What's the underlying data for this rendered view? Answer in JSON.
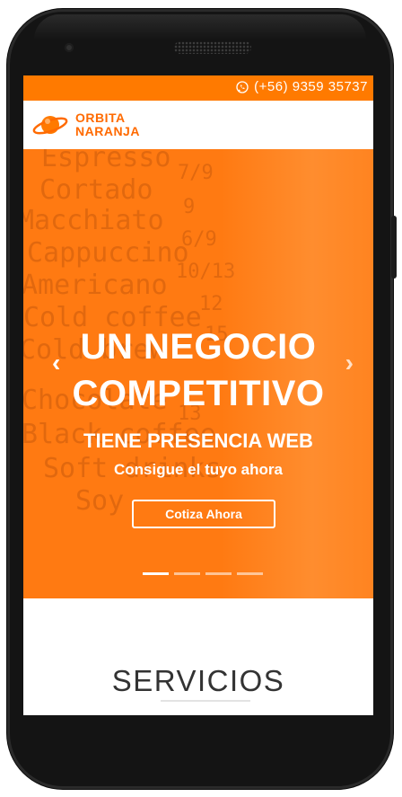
{
  "topbar": {
    "phone": "(+56) 9359 35737",
    "icon": "whatsapp-icon"
  },
  "header": {
    "logo_line1": "ORBITA",
    "logo_line2": "NARANJA",
    "logo_icon": "planet-icon"
  },
  "hero": {
    "headline_line1": "UN NEGOCIO",
    "headline_line2": "COMPETITIVO",
    "subtitle": "TIENE PRESENCIA WEB",
    "tagline": "Consigue el tuyo ahora",
    "cta_label": "Cotiza Ahora",
    "prev_arrow": "‹",
    "next_arrow": "›",
    "slide_count": 4,
    "active_slide": 1,
    "background_menu": [
      "Espresso",
      "Cortado",
      "Macchiato",
      "Cappuccino",
      "Americano",
      "Cold coffee",
      "Cold brew",
      "Chocolate",
      "Black coffee",
      "Soft drinks",
      "Soy"
    ],
    "background_prices": [
      "7/9",
      "9",
      "6/9",
      "10/13",
      "12",
      "15",
      "13"
    ]
  },
  "section": {
    "title": "SERVICIOS"
  },
  "colors": {
    "accent": "#ff7a00",
    "hero": "#ff7a12",
    "phone_body": "#141414"
  }
}
